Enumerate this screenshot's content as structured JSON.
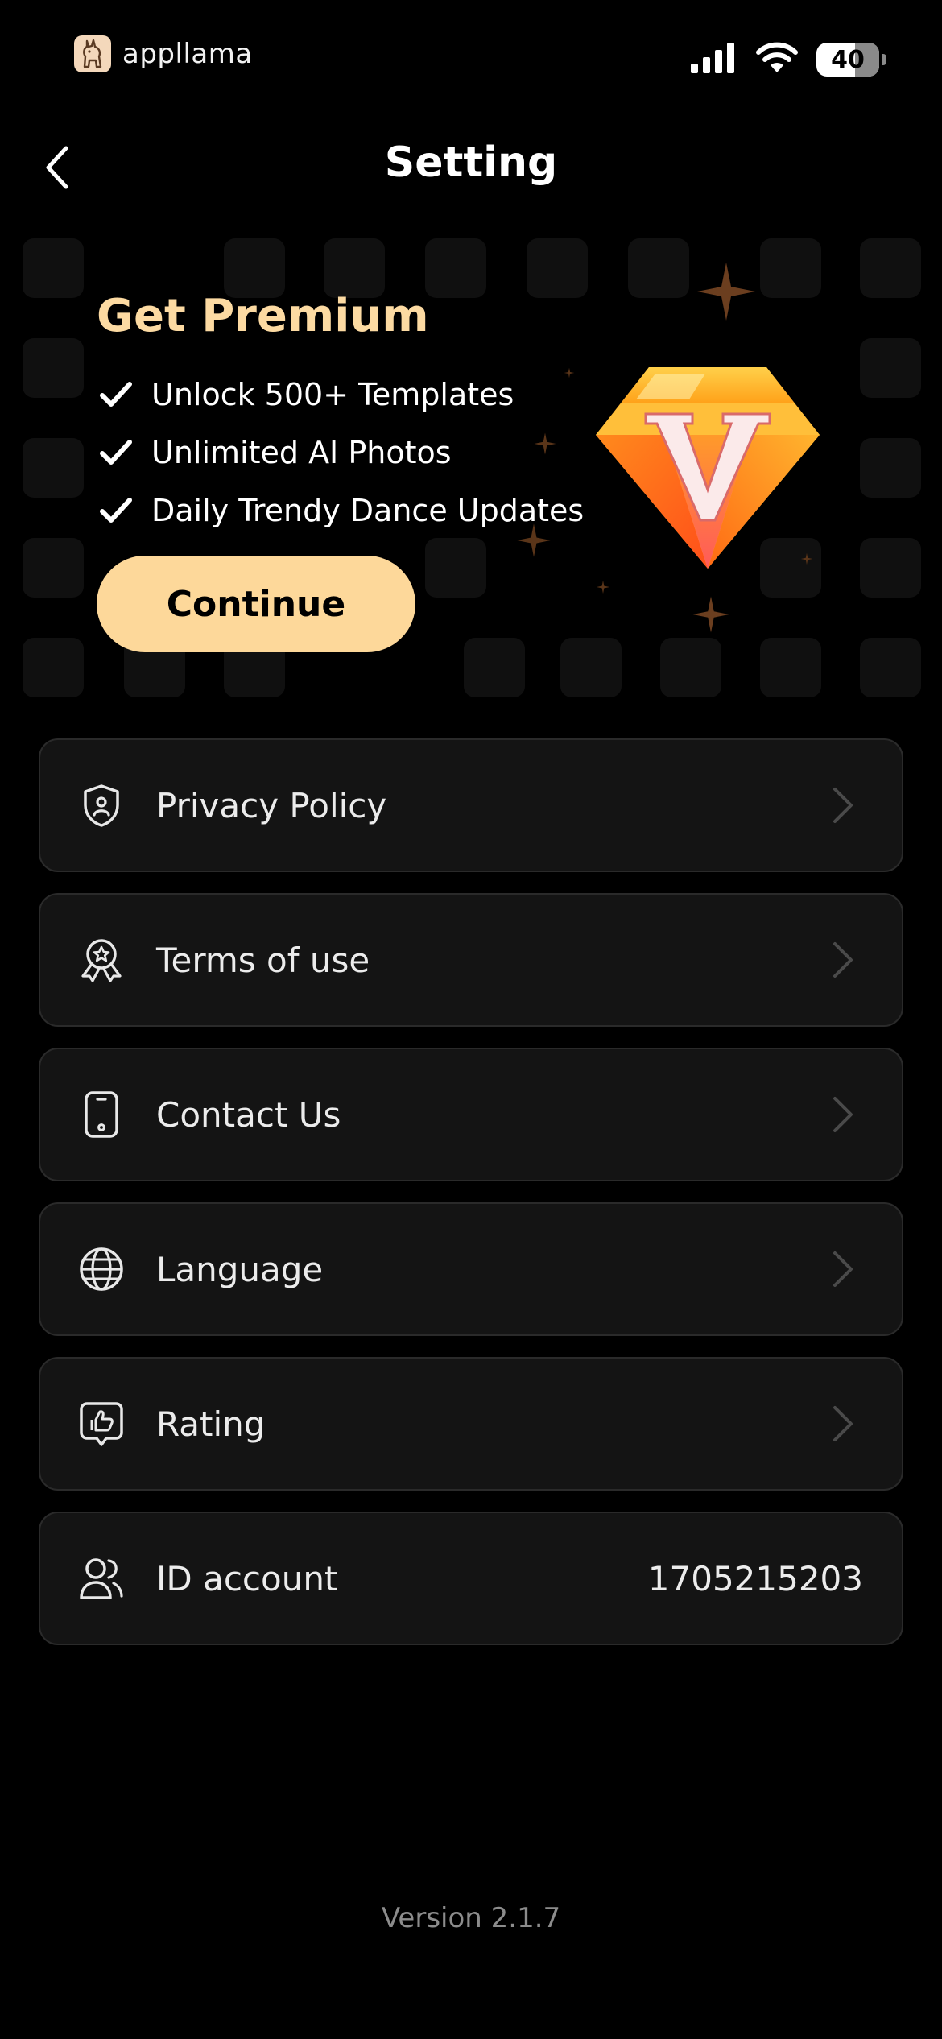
{
  "status_bar": {
    "brand_name": "appllama",
    "battery_level": "40",
    "signal_icon": "cellular-signal-icon",
    "wifi_icon": "wifi-icon"
  },
  "header": {
    "title": "Setting",
    "back_icon": "chevron-left-icon"
  },
  "premium": {
    "title": "Get Premium",
    "features": [
      "Unlock 500+ Templates",
      "Unlimited AI Photos",
      "Daily Trendy Dance Updates"
    ],
    "cta_label": "Continue",
    "badge_icon": "diamond-v-icon",
    "accent_color": "#fcdaa2"
  },
  "settings": {
    "items": [
      {
        "label": "Privacy Policy",
        "icon": "shield-user-icon"
      },
      {
        "label": "Terms of use",
        "icon": "award-ribbon-icon"
      },
      {
        "label": "Contact Us",
        "icon": "phone-device-icon"
      },
      {
        "label": "Language",
        "icon": "globe-icon"
      },
      {
        "label": "Rating",
        "icon": "thumbs-up-chat-icon"
      }
    ],
    "account": {
      "label": "ID account",
      "value": "1705215203",
      "icon": "users-icon"
    }
  },
  "footer": {
    "version": "Version 2.1.7"
  }
}
